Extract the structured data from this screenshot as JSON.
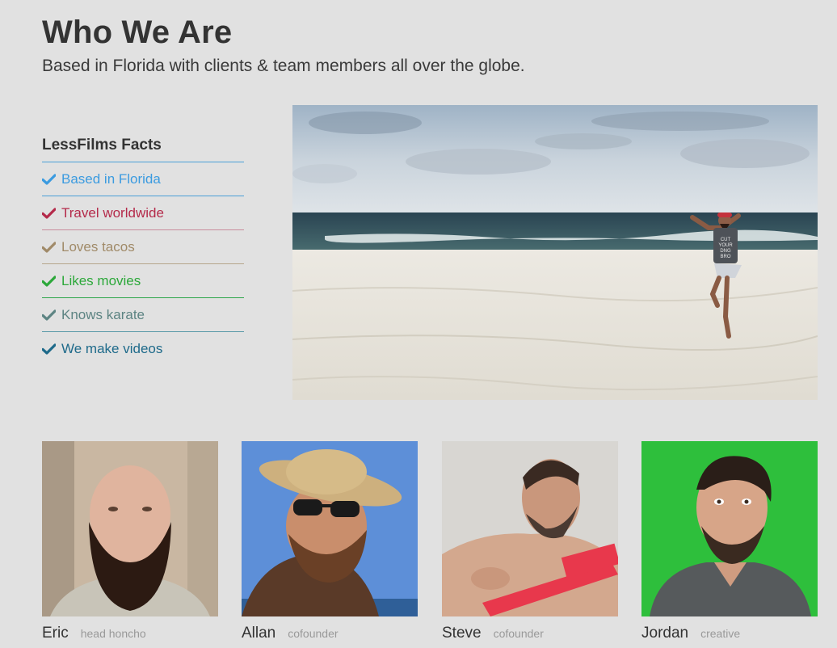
{
  "header": {
    "title": "Who We Are",
    "subtitle": "Based in Florida with clients & team members all over the globe."
  },
  "facts": {
    "heading": "LessFilms Facts",
    "items": [
      {
        "label": "Based in Florida",
        "color": "#3b9be0",
        "line": "#4a9fd8"
      },
      {
        "label": "Travel worldwide",
        "color": "#b42a4a",
        "line": "#c88c9c"
      },
      {
        "label": "Loves tacos",
        "color": "#a08a68",
        "line": "#b6a68c"
      },
      {
        "label": "Likes movies",
        "color": "#2ca83a",
        "line": "#2ea64a"
      },
      {
        "label": "Knows karate",
        "color": "#5d8483",
        "line": "#5a9aa8"
      },
      {
        "label": "We make videos",
        "color": "#1e6a8a",
        "line": "#1e6a8a"
      }
    ]
  },
  "hero": {
    "image": "beach-photo",
    "shirt_text": [
      "CUT",
      "YOUR",
      "DNG",
      "BRO"
    ]
  },
  "team": [
    {
      "name": "Eric",
      "role": "head honcho"
    },
    {
      "name": "Allan",
      "role": "cofounder"
    },
    {
      "name": "Steve",
      "role": "cofounder"
    },
    {
      "name": "Jordan",
      "role": "creative"
    }
  ]
}
